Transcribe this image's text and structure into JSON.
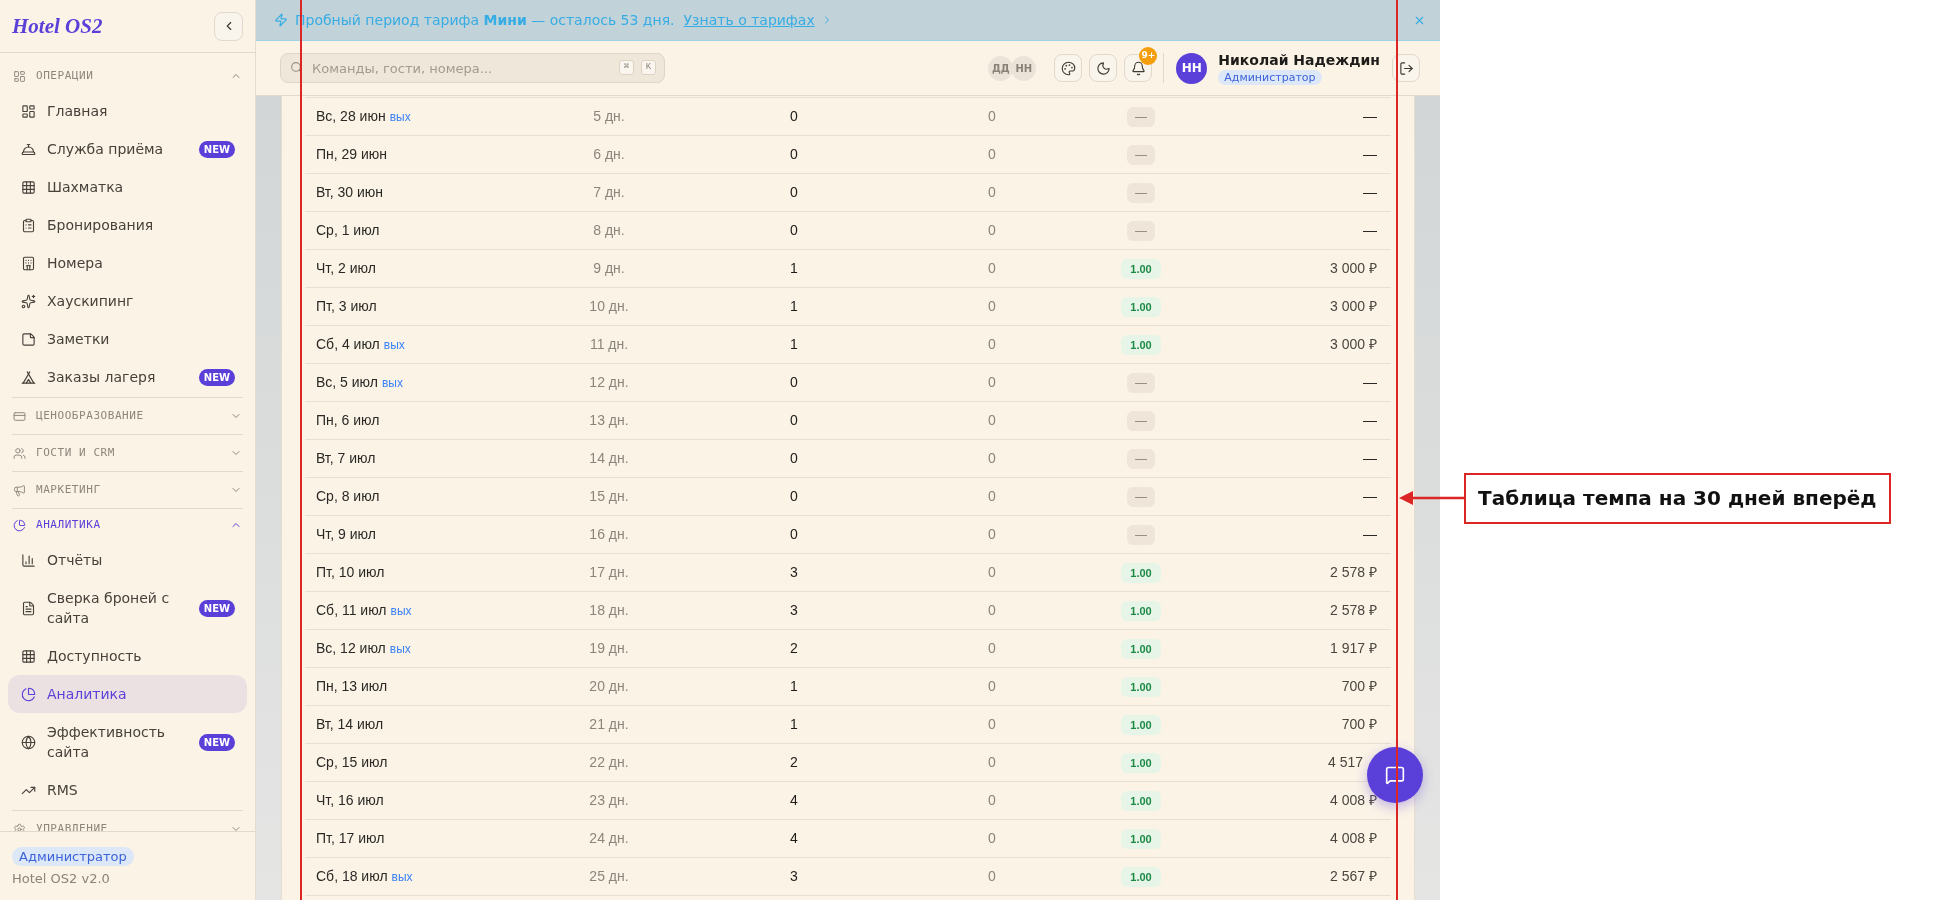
{
  "sidebar": {
    "logo": "Hotel OS2",
    "sections": [
      {
        "title": "ОПЕРАЦИИ",
        "expanded": true,
        "items": [
          {
            "label": "Главная",
            "selected": false
          },
          {
            "label": "Служба приёма",
            "badge": "NEW",
            "selected": false
          },
          {
            "label": "Шахматка",
            "selected": false
          },
          {
            "label": "Бронирования",
            "selected": false
          },
          {
            "label": "Номера",
            "selected": false
          },
          {
            "label": "Хаускипинг",
            "selected": false
          },
          {
            "label": "Заметки",
            "selected": false
          },
          {
            "label": "Заказы лагеря",
            "badge": "NEW",
            "selected": false
          }
        ]
      },
      {
        "title": "ЦЕНООБРАЗОВАНИЕ",
        "expanded": false
      },
      {
        "title": "ГОСТИ И CRM",
        "expanded": false
      },
      {
        "title": "МАРКЕТИНГ",
        "expanded": false
      },
      {
        "title": "АНАЛИТИКА",
        "expanded": true,
        "items": [
          {
            "label": "Отчёты",
            "selected": false
          },
          {
            "label": "Сверка броней с сайта",
            "badge": "NEW",
            "selected": false
          },
          {
            "label": "Доступность",
            "selected": false
          },
          {
            "label": "Аналитика",
            "selected": true
          },
          {
            "label": "Эффективность сайта",
            "badge": "NEW",
            "selected": false
          },
          {
            "label": "RMS",
            "selected": false
          }
        ]
      },
      {
        "title": "УПРАВЛЕНИЕ",
        "expanded": false
      }
    ],
    "footer": {
      "role": "Администратор",
      "version": "Hotel OS2 v2.0"
    }
  },
  "banner": {
    "message": "Пробный период тарифа **Мини** — осталось 53 дня.",
    "link": "Узнать о тарифах"
  },
  "header": {
    "search": {
      "placeholder": "Команды, гости, номера...",
      "shortcut": [
        "⌘",
        "K"
      ]
    },
    "presence": [
      "ДД",
      "НН"
    ],
    "notification_count": "9+",
    "user": {
      "initials": "НН",
      "name": "Николай Надеждин",
      "role": "Администратор"
    }
  },
  "table": {
    "rows": [
      {
        "kind": "empty",
        "date": "Вс, 28 июн",
        "tag": "вых",
        "column_2": "5 дн.",
        "column_3": "0",
        "column_4": "0",
        "column_5": "—",
        "column_6": "—",
        "under_chat_button": false
      },
      {
        "kind": "empty",
        "date": "Пн, 29 июн",
        "column_2": "6 дн.",
        "column_3": "0",
        "column_4": "0",
        "column_5": "—",
        "column_6": "—",
        "under_chat_button": false
      },
      {
        "kind": "empty",
        "date": "Вт, 30 июн",
        "column_2": "7 дн.",
        "column_3": "0",
        "column_4": "0",
        "column_5": "—",
        "column_6": "—",
        "under_chat_button": false
      },
      {
        "kind": "empty",
        "date": "Ср, 1 июл",
        "column_2": "8 дн.",
        "column_3": "0",
        "column_4": "0",
        "column_5": "—",
        "column_6": "—",
        "under_chat_button": false
      },
      {
        "kind": "booked",
        "date": "Чт, 2 июл",
        "column_2": "9 дн.",
        "column_3": "1",
        "column_4": "0",
        "column_5": "1.00",
        "column_6": "3 000 ₽",
        "under_chat_button": false
      },
      {
        "kind": "booked",
        "date": "Пт, 3 июл",
        "column_2": "10 дн.",
        "column_3": "1",
        "column_4": "0",
        "column_5": "1.00",
        "column_6": "3 000 ₽",
        "under_chat_button": false
      },
      {
        "kind": "booked",
        "date": "Сб, 4 июл",
        "tag": "вых",
        "column_2": "11 дн.",
        "column_3": "1",
        "column_4": "0",
        "column_5": "1.00",
        "column_6": "3 000 ₽",
        "under_chat_button": false
      },
      {
        "kind": "empty",
        "date": "Вс, 5 июл",
        "tag": "вых",
        "column_2": "12 дн.",
        "column_3": "0",
        "column_4": "0",
        "column_5": "—",
        "column_6": "—",
        "under_chat_button": false
      },
      {
        "kind": "empty",
        "date": "Пн, 6 июл",
        "column_2": "13 дн.",
        "column_3": "0",
        "column_4": "0",
        "column_5": "—",
        "column_6": "—",
        "under_chat_button": false
      },
      {
        "kind": "empty",
        "date": "Вт, 7 июл",
        "column_2": "14 дн.",
        "column_3": "0",
        "column_4": "0",
        "column_5": "—",
        "column_6": "—",
        "under_chat_button": false
      },
      {
        "kind": "empty",
        "date": "Ср, 8 июл",
        "column_2": "15 дн.",
        "column_3": "0",
        "column_4": "0",
        "column_5": "—",
        "column_6": "—",
        "under_chat_button": false
      },
      {
        "kind": "empty",
        "date": "Чт, 9 июл",
        "column_2": "16 дн.",
        "column_3": "0",
        "column_4": "0",
        "column_5": "—",
        "column_6": "—",
        "under_chat_button": false
      },
      {
        "kind": "booked",
        "date": "Пт, 10 июл",
        "column_2": "17 дн.",
        "column_3": "3",
        "column_4": "0",
        "column_5": "1.00",
        "column_6": "2 578 ₽",
        "under_chat_button": false
      },
      {
        "kind": "booked",
        "date": "Сб, 11 июл",
        "tag": "вых",
        "column_2": "18 дн.",
        "column_3": "3",
        "column_4": "0",
        "column_5": "1.00",
        "column_6": "2 578 ₽",
        "under_chat_button": false
      },
      {
        "kind": "booked",
        "date": "Вс, 12 июл",
        "tag": "вых",
        "column_2": "19 дн.",
        "column_3": "2",
        "column_4": "0",
        "column_5": "1.00",
        "column_6": "1 917 ₽",
        "under_chat_button": false
      },
      {
        "kind": "booked",
        "date": "Пн, 13 июл",
        "column_2": "20 дн.",
        "column_3": "1",
        "column_4": "0",
        "column_5": "1.00",
        "column_6": "700 ₽",
        "under_chat_button": false
      },
      {
        "kind": "booked",
        "date": "Вт, 14 июл",
        "column_2": "21 дн.",
        "column_3": "1",
        "column_4": "0",
        "column_5": "1.00",
        "column_6": "700 ₽",
        "under_chat_button": false
      },
      {
        "kind": "booked",
        "date": "Ср, 15 июл",
        "column_2": "22 дн.",
        "column_3": "2",
        "column_4": "0",
        "column_5": "1.00",
        "column_6": "4 517",
        "under_chat_button": true
      },
      {
        "kind": "booked",
        "date": "Чт, 16 июл",
        "column_2": "23 дн.",
        "column_3": "4",
        "column_4": "0",
        "column_5": "1.00",
        "column_6": "4 008 ₽",
        "under_chat_button": false
      },
      {
        "kind": "booked",
        "date": "Пт, 17 июл",
        "column_2": "24 дн.",
        "column_3": "4",
        "column_4": "0",
        "column_5": "1.00",
        "column_6": "4 008 ₽",
        "under_chat_button": false
      },
      {
        "kind": "booked",
        "date": "Сб, 18 июл",
        "tag": "вых",
        "column_2": "25 дн.",
        "column_3": "3",
        "column_4": "0",
        "column_5": "1.00",
        "column_6": "2 567 ₽",
        "under_chat_button": false
      }
    ]
  },
  "annotation": {
    "label": "Таблица темпа на 30 дней вперёд"
  }
}
